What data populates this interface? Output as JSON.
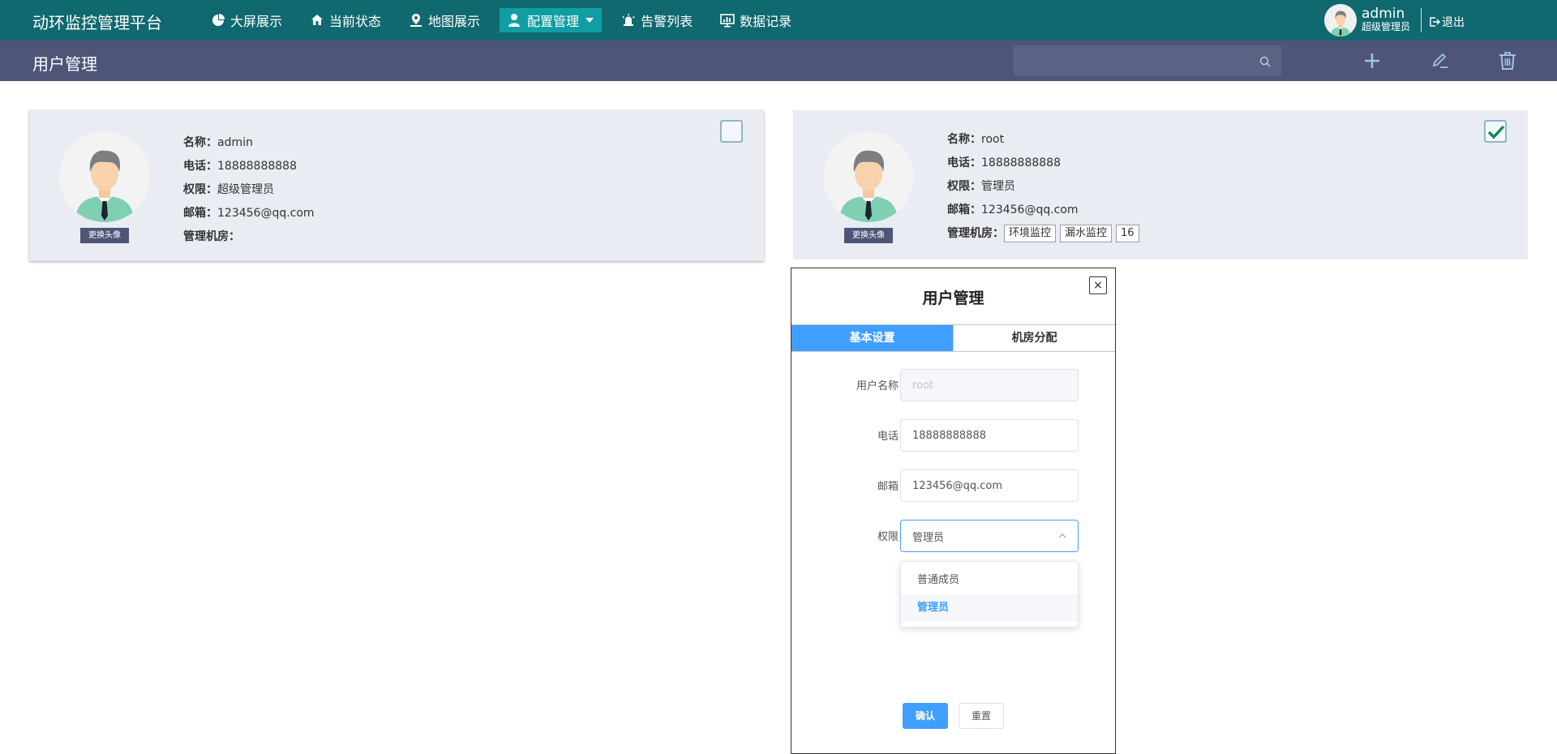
{
  "app": {
    "title": "动环监控管理平台"
  },
  "nav": [
    {
      "label": "大屏展示",
      "icon": "pie-chart-icon"
    },
    {
      "label": "当前状态",
      "icon": "home-icon"
    },
    {
      "label": "地图展示",
      "icon": "map-pin-icon"
    },
    {
      "label": "配置管理",
      "icon": "user-config-icon",
      "active": true
    },
    {
      "label": "告警列表",
      "icon": "alarm-icon"
    },
    {
      "label": "数据记录",
      "icon": "monitor-chart-icon"
    }
  ],
  "user": {
    "name": "admin",
    "role": "超级管理员",
    "logout": "退出"
  },
  "page": {
    "title": "用户管理",
    "search_placeholder": ""
  },
  "cards": [
    {
      "name_label": "名称：",
      "name": "admin",
      "phone_label": "电话：",
      "phone": "18888888888",
      "perm_label": "权限：",
      "perm": "超级管理员",
      "email_label": "邮箱：",
      "email": "123456@qq.com",
      "rooms_label": "管理机房：",
      "rooms": [],
      "change_avatar": "更换头像",
      "checked": false
    },
    {
      "name_label": "名称：",
      "name": "root",
      "phone_label": "电话：",
      "phone": "18888888888",
      "perm_label": "权限：",
      "perm": "管理员",
      "email_label": "邮箱：",
      "email": "123456@qq.com",
      "rooms_label": "管理机房：",
      "rooms": [
        "环境监控",
        "漏水监控",
        "16"
      ],
      "change_avatar": "更换头像",
      "checked": true
    }
  ],
  "modal": {
    "title": "用户管理",
    "close": "×",
    "tabs": [
      "基本设置",
      "机房分配"
    ],
    "active_tab": 0,
    "fields": {
      "username_label": "用户名称",
      "username_value": "root",
      "phone_label": "电话",
      "phone_value": "18888888888",
      "email_label": "邮箱",
      "email_value": "123456@qq.com",
      "perm_label": "权限",
      "perm_value": "管理员"
    },
    "dropdown": [
      "普通成员",
      "管理员"
    ],
    "confirm": "确认",
    "reset": "重置"
  },
  "colors": {
    "nav_bg": "#10696f",
    "nav_active": "#0f9ea3",
    "subbar": "#4e5577",
    "card_bg": "#e9ecf3",
    "primary": "#409eff"
  }
}
